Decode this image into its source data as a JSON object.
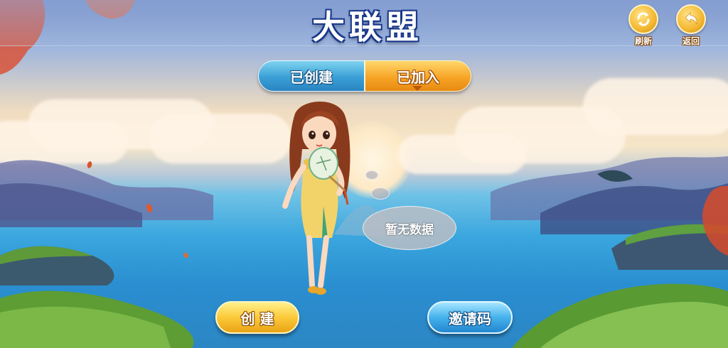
{
  "header": {
    "title": "大联盟",
    "refresh_label": "刷新",
    "back_label": "返回"
  },
  "tabs": [
    {
      "label": "已创建",
      "selected": false
    },
    {
      "label": "已加入",
      "selected": true
    }
  ],
  "empty_state": {
    "message": "暂无数据"
  },
  "actions": {
    "create_label": "创 建",
    "invite_label": "邀请码"
  },
  "icons": {
    "refresh": "refresh-icon",
    "back": "back-arrow-icon"
  },
  "colors": {
    "tab_active": "#f7a426",
    "tab_inactive": "#3a9fd6",
    "button_create": "#fbc93a",
    "button_invite": "#45b2ec"
  }
}
